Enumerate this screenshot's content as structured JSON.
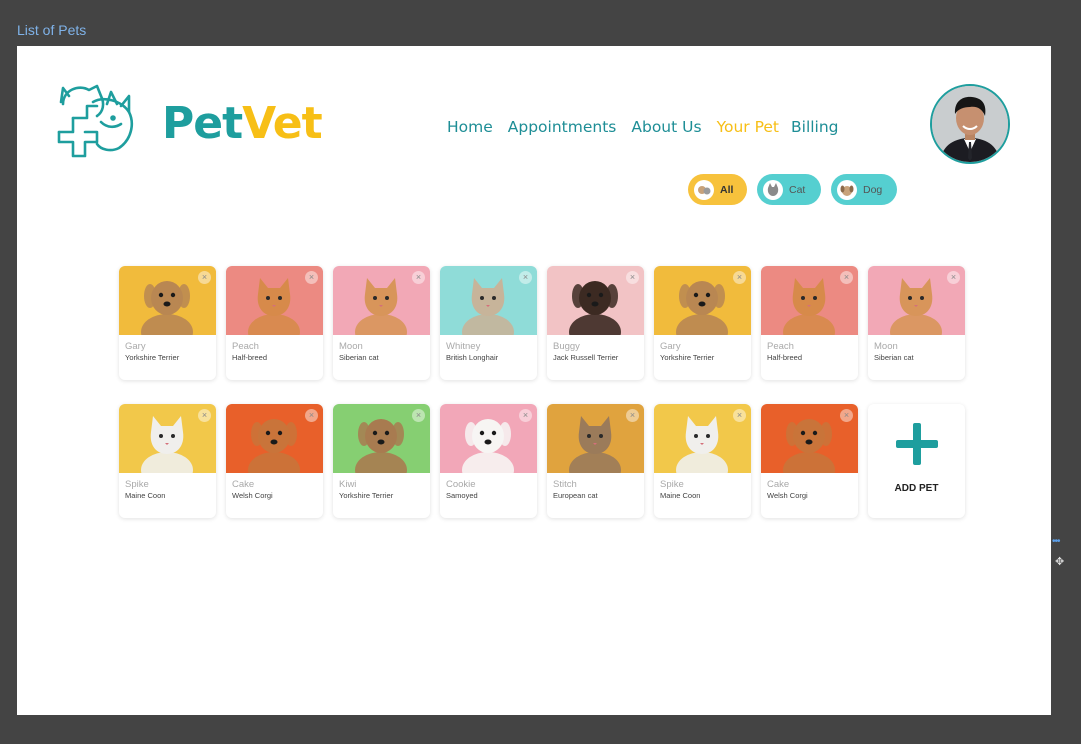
{
  "frame_label": "List of Pets",
  "brand": {
    "part1": "Pet",
    "part2": "Vet"
  },
  "nav": [
    {
      "label": "Home",
      "active": false
    },
    {
      "label": "Appointments",
      "active": false
    },
    {
      "label": "About Us",
      "active": false
    },
    {
      "label": "Your Pet",
      "active": true
    },
    {
      "label": "Billing",
      "active": false
    }
  ],
  "filters": {
    "all": "All",
    "cat": "Cat",
    "dog": "Dog"
  },
  "colors": {
    "teal": "#1e9e9e",
    "yellow": "#f7bf16",
    "chip_teal": "#55cfd0"
  },
  "pets_row1": [
    {
      "name": "Gary",
      "breed": "Yorkshire Terrier",
      "bg": "#f1bb3c",
      "animal": "dog-icon",
      "fur": "#b98752"
    },
    {
      "name": "Peach",
      "breed": "Half-breed",
      "bg": "#ec8a82",
      "animal": "cat-icon",
      "fur": "#d78a4a"
    },
    {
      "name": "Moon",
      "breed": "Siberian cat",
      "bg": "#f2a8b6",
      "animal": "cat-icon",
      "fur": "#d8955a"
    },
    {
      "name": "Whitney",
      "breed": "British Longhair",
      "bg": "#8fdcd8",
      "animal": "cat-icon",
      "fur": "#c7b49a"
    },
    {
      "name": "Buggy",
      "breed": "Jack Russell Terrier",
      "bg": "#f2c3c5",
      "animal": "dog-icon",
      "fur": "#3c2a22"
    },
    {
      "name": "Gary",
      "breed": "Yorkshire Terrier",
      "bg": "#f1bb3c",
      "animal": "dog-icon",
      "fur": "#b98752"
    },
    {
      "name": "Peach",
      "breed": "Half-breed",
      "bg": "#ec8a82",
      "animal": "cat-icon",
      "fur": "#d78a4a"
    },
    {
      "name": "Moon",
      "breed": "Siberian cat",
      "bg": "#f2a8b6",
      "animal": "cat-icon",
      "fur": "#d8955a"
    }
  ],
  "pets_row2": [
    {
      "name": "Spike",
      "breed": "Maine Coon",
      "bg": "#f2c84a",
      "animal": "cat-icon",
      "fur": "#f0efec"
    },
    {
      "name": "Cake",
      "breed": "Welsh Corgi",
      "bg": "#e8602a",
      "animal": "dog-icon",
      "fur": "#c9743a"
    },
    {
      "name": "Kiwi",
      "breed": "Yorkshire Terrier",
      "bg": "#86cf72",
      "animal": "dog-icon",
      "fur": "#a87b50"
    },
    {
      "name": "Cookie",
      "breed": "Samoyed",
      "bg": "#f2a7b8",
      "animal": "dog-icon",
      "fur": "#f7f5f3"
    },
    {
      "name": "Stitch",
      "breed": "European cat",
      "bg": "#e0a33e",
      "animal": "cat-icon",
      "fur": "#9b7b5a"
    },
    {
      "name": "Spike",
      "breed": "Maine Coon",
      "bg": "#f2c84a",
      "animal": "cat-icon",
      "fur": "#f0efec"
    },
    {
      "name": "Cake",
      "breed": "Welsh Corgi",
      "bg": "#e8602a",
      "animal": "dog-icon",
      "fur": "#c9743a"
    }
  ],
  "add_pet_label": "ADD PET",
  "close_glyph": "×"
}
